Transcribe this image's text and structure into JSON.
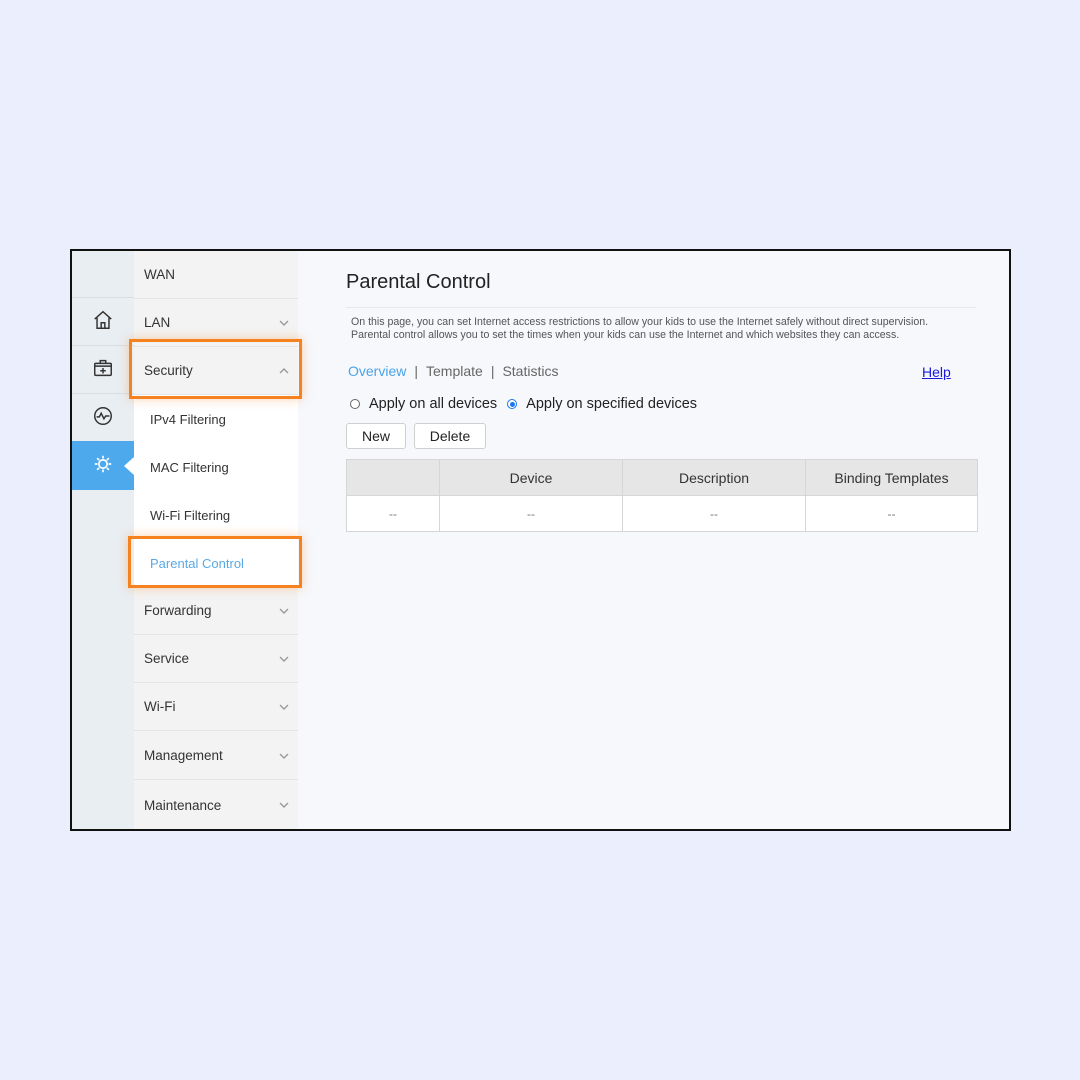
{
  "rail": {
    "items": [
      {
        "icon": "home-icon",
        "label": "Home"
      },
      {
        "icon": "toolbox-icon",
        "label": "Tools"
      },
      {
        "icon": "status-icon",
        "label": "Status"
      },
      {
        "icon": "settings-gear-icon",
        "label": "Settings",
        "active": true
      }
    ]
  },
  "menu": {
    "items": [
      {
        "label": "WAN",
        "chevron": "none"
      },
      {
        "label": "LAN",
        "chevron": "down"
      },
      {
        "label": "Security",
        "chevron": "up",
        "expanded": true
      },
      {
        "label": "Forwarding",
        "chevron": "down"
      },
      {
        "label": "Service",
        "chevron": "down"
      },
      {
        "label": "Wi-Fi",
        "chevron": "down"
      },
      {
        "label": "Management",
        "chevron": "down"
      },
      {
        "label": "Maintenance",
        "chevron": "down"
      }
    ],
    "security_subitems": [
      {
        "label": "IPv4 Filtering"
      },
      {
        "label": "MAC Filtering"
      },
      {
        "label": "Wi-Fi Filtering"
      },
      {
        "label": "Parental Control",
        "active": true
      }
    ]
  },
  "content": {
    "title": "Parental Control",
    "description_line1": "On this page, you can set Internet access restrictions to allow your kids to use the Internet safely without direct supervision.",
    "description_line2": "Parental control allows you to set the times when your kids can use the Internet and which websites they can access.",
    "tabs": [
      {
        "label": "Overview",
        "active": true
      },
      {
        "label": "Template"
      },
      {
        "label": "Statistics"
      }
    ],
    "tab_separator": "|",
    "help_label": "Help",
    "radio_options": [
      {
        "label": "Apply on all devices",
        "checked": false
      },
      {
        "label": "Apply on specified devices",
        "checked": true
      }
    ],
    "buttons": {
      "new": "New",
      "delete": "Delete"
    },
    "table": {
      "columns": [
        "",
        "Device",
        "Description",
        "Binding Templates"
      ],
      "rows": [
        [
          "--",
          "--",
          "--",
          "--"
        ]
      ]
    }
  },
  "colors": {
    "accent_blue": "#4ea9ec",
    "highlight_orange": "#f5821f",
    "link_blue": "#1a1adb",
    "page_background": "#eaeefd"
  }
}
